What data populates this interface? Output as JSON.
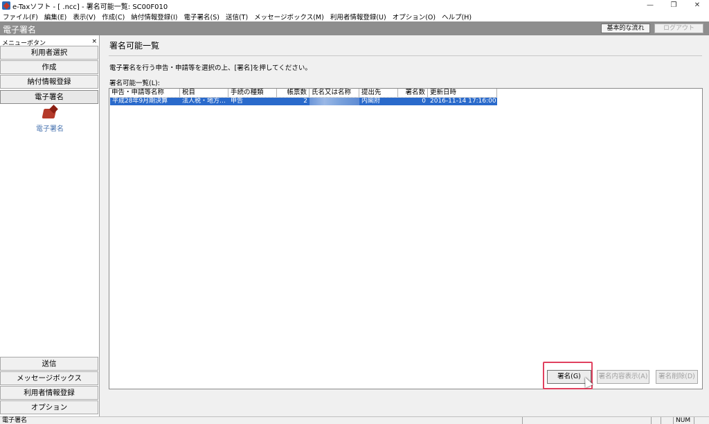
{
  "window": {
    "title": "e-Taxソフト - [                    .ncc] - 署名可能一覧: SC00F010",
    "minimize": "—",
    "maximize": "❐",
    "close": "✕"
  },
  "menubar": [
    "ファイル(F)",
    "編集(E)",
    "表示(V)",
    "作成(C)",
    "納付情報登録(I)",
    "電子署名(S)",
    "送信(T)",
    "メッセージボックス(M)",
    "利用者情報登録(U)",
    "オプション(O)",
    "ヘルプ(H)"
  ],
  "section": {
    "title": "電子署名",
    "flow_button": "基本的な流れ",
    "logout_button": "ログアウト"
  },
  "sidebar": {
    "header": "メニューボタン",
    "close": "×",
    "top_items": [
      "利用者選択",
      "作成",
      "納付情報登録",
      "電子署名"
    ],
    "active_index": 3,
    "icon_label": "電子署名",
    "bottom_items": [
      "送信",
      "メッセージボックス",
      "利用者情報登録",
      "オプション"
    ]
  },
  "main": {
    "page_title": "署名可能一覧",
    "instruction": "電子署名を行う申告・申請等を選択の上、[署名]を押してください。",
    "list_label": "署名可能一覧(L):",
    "columns": [
      "申告・申請等名称",
      "税目",
      "手続の種類",
      "帳票数",
      "氏名又は名称",
      "提出先",
      "署名数",
      "更新日時"
    ],
    "rows": [
      [
        "平成28年9月期決算",
        "法人税・地方…",
        "申告",
        "2",
        "",
        "内閣府",
        "0",
        "2016-11-14 17:16:00"
      ]
    ],
    "buttons": {
      "sign": "署名(G)",
      "view": "署名内容表示(A)",
      "delete": "署名削除(D)"
    }
  },
  "statusbar": {
    "text": "電子署名",
    "num": "NUM"
  },
  "colors": {
    "selection": "#2a6acb",
    "highlight": "#e0405e",
    "section_bar": "#8e8e8e"
  }
}
